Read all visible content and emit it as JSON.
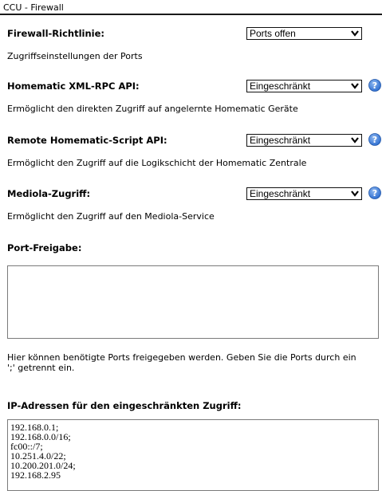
{
  "window": {
    "title": "CCU - Firewall"
  },
  "firewall_policy": {
    "label": "Firewall-Richtlinie:",
    "value": "Ports offen",
    "description": "Zugriffseinstellungen der Ports"
  },
  "xmlrpc": {
    "label": "Homematic XML-RPC API:",
    "value": "Eingeschränkt",
    "description": "Ermöglicht den direkten Zugriff auf angelernte Homematic Geräte"
  },
  "script_api": {
    "label": "Remote Homematic-Script API:",
    "value": "Eingeschränkt",
    "description": "Ermöglicht den Zugriff auf die Logikschicht der Homematic Zentrale"
  },
  "mediola": {
    "label": "Mediola-Zugriff:",
    "value": "Eingeschränkt",
    "description": "Ermöglicht den Zugriff auf den Mediola-Service"
  },
  "port_share": {
    "label": "Port-Freigabe:",
    "value": "",
    "description_line1": "Hier können benötigte Ports freigegeben werden. Geben Sie die Ports durch ein",
    "description_line2": "';' getrennt ein."
  },
  "ip_restricted": {
    "label": "IP-Adressen für den eingeschränkten Zugriff:",
    "lines": [
      "192.168.0.1;",
      "192.168.0.0/16;",
      "fc00::/7;",
      "10.251.4.0/22;",
      "10.200.201.0/24;",
      "192.168.2.95"
    ]
  },
  "icons": {
    "help": "help-question-icon",
    "dropdown": "chevron-down-icon"
  },
  "colors": {
    "help_blue": "#2f6fd1",
    "title_rule": "#1a1a1a"
  }
}
